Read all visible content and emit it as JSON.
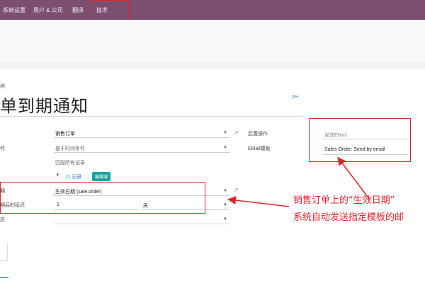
{
  "menu": {
    "item1": "系统设置",
    "item2": "用户 & 公司",
    "item3": "翻译",
    "item4": "技术"
  },
  "form": {
    "field_caption": "称",
    "title": "单到期通知",
    "counter": "2",
    "model": {
      "label": "",
      "value": "销售订单"
    },
    "trigger": {
      "label": "件",
      "value": "基于时间条件"
    },
    "filter": {
      "value": "匹配所有记录"
    },
    "record_count": "11 记录",
    "edit_domain": "编辑域",
    "date_field": {
      "label": "期",
      "value": "生效日期 (sale.order)"
    },
    "delay": {
      "label": "期后的延迟",
      "value": "1",
      "unit": "天"
    },
    "last_label": "历",
    "action_label": "后置操作",
    "action_value": "发送EMail",
    "template_label": "EMail模板",
    "template_value": "Sales Order: Send by email"
  },
  "annotation": {
    "line1": "销售订单上的“生效日期”",
    "line2": "系统自动发送指定模板的邮"
  },
  "colors": {
    "topbar": "#7c4f70",
    "annotation": "#e0242b",
    "badge": "#1aa29e"
  },
  "icons": {
    "external": "external-link-icon",
    "caret": "caret-down-icon",
    "plus": "plus-icon"
  }
}
